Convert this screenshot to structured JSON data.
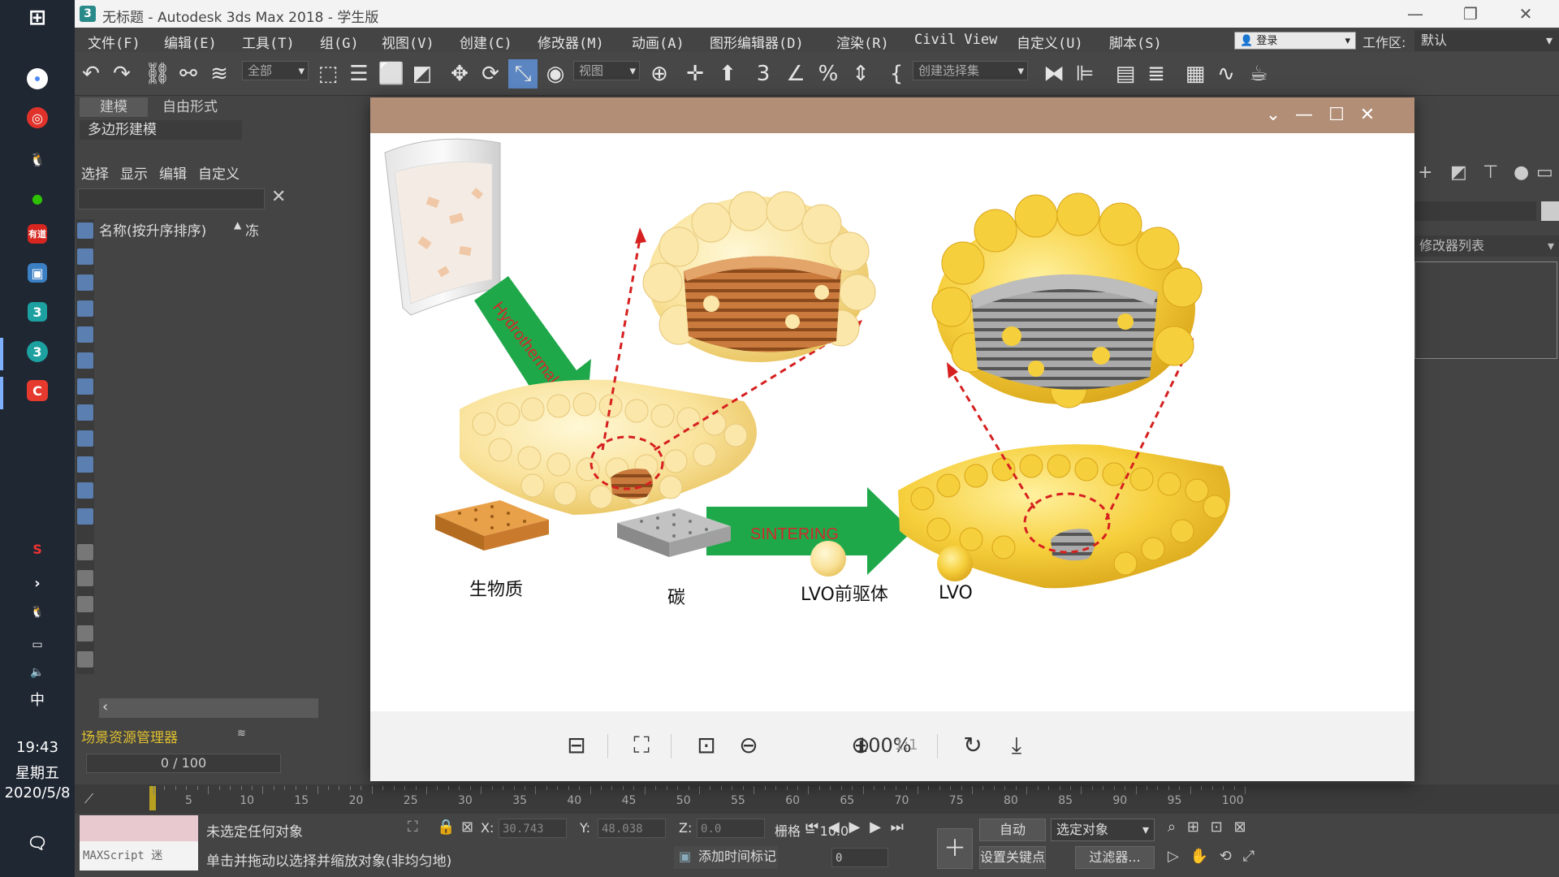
{
  "taskbar": {
    "time": "19:43",
    "weekday": "星期五",
    "date": "2020/5/8",
    "ime": "中"
  },
  "titlebar": {
    "title": "无标题 - Autodesk 3ds Max 2018 - 学生版"
  },
  "menu": [
    "文件(F)",
    "编辑(E)",
    "工具(T)",
    "组(G)",
    "视图(V)",
    "创建(C)",
    "修改器(M)",
    "动画(A)",
    "图形编辑器(D)",
    "渲染(R)",
    "Civil View",
    "自定义(U)",
    "脚本(S)"
  ],
  "login": "登录",
  "workspace": {
    "label": "工作区:",
    "value": "默认"
  },
  "toolbar": {
    "filter_all": "全部",
    "view_dropdown": "视图",
    "selection_set": "创建选择集"
  },
  "ribbon": {
    "tabs": [
      "建模",
      "自由形式"
    ],
    "poly_label": "多边形建模"
  },
  "explorer": {
    "tabs": [
      "选择",
      "显示",
      "编辑",
      "自定义"
    ],
    "column_name": "名称(按升序排序)",
    "column_frozen": "冻",
    "scene_manager": "场景资源管理器",
    "frame_counter": "0 / 100"
  },
  "command_panel": {
    "modifier_list": "修改器列表"
  },
  "timeline": {
    "ticks": [
      "5",
      "10",
      "15",
      "20",
      "25",
      "30",
      "35",
      "40",
      "45",
      "50",
      "55",
      "60",
      "65",
      "70",
      "75",
      "80",
      "85",
      "90",
      "95",
      "100"
    ]
  },
  "status": {
    "maxscript": "MAXScript 迷",
    "no_selection": "未选定任何对象",
    "hint": "单击并拖动以选择并缩放对象(非均匀地)",
    "x_label": "X:",
    "x_value": "30.743",
    "y_label": "Y:",
    "y_value": "48.038",
    "z_label": "Z:",
    "z_value": "0.0",
    "grid": "栅格 = 10.0",
    "add_time_tag": "添加时间标记",
    "auto": "自动",
    "selected_object": "选定对象",
    "set_key": "设置关键点",
    "filters": "过滤器...",
    "frame_value": "0"
  },
  "viewer": {
    "zoom": "100%",
    "image": {
      "hydrothermal": "Hydrothermal",
      "sintering": "SINTERING",
      "legend": [
        "生物质",
        "碳",
        "LVO前驱体",
        "LVO"
      ]
    }
  },
  "colors": {
    "viewer_titlebar": "#b28e76",
    "arrow_green": "#1fa84a",
    "dash_red": "#d62020",
    "lvo_yellow": "#f2cc4a",
    "biomass_orange": "#d98a2e",
    "carbon_gray": "#9a9a9a"
  }
}
